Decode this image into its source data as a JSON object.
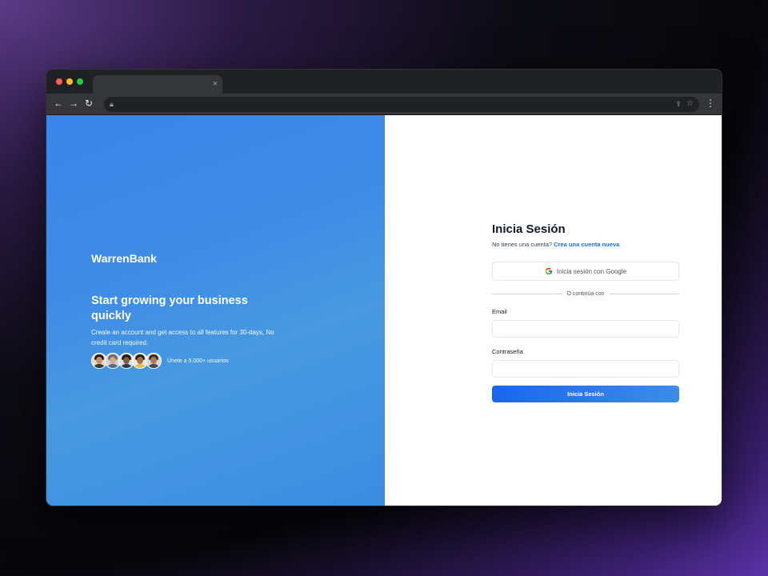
{
  "browser": {
    "tab_close": "×",
    "back_icon": "arrow-left",
    "forward_icon": "arrow-right",
    "reload_icon": "reload",
    "menu_icon": "kebab"
  },
  "left": {
    "brand": "WarrenBank",
    "headline": "Start growing your business quickly",
    "subtitle": "Create an account and get access to all features for 30-days, No credit card required.",
    "join_text": "Únete a 5.000+ usuarios",
    "avatar_count": 5,
    "gradient_colors": [
      "#3a85ea",
      "#4799e0"
    ]
  },
  "login": {
    "title": "Inicia Sesión",
    "no_account": "No tienes una cuenta?",
    "create_link": "Crea una cuenta nueva",
    "google_button": "Inicia sesión con Google",
    "divider": "O continúa con",
    "email_label": "Email",
    "email_value": "",
    "password_label": "Contraseña",
    "password_value": "",
    "submit": "Inicia Sesión",
    "accent": "#1967ec"
  }
}
